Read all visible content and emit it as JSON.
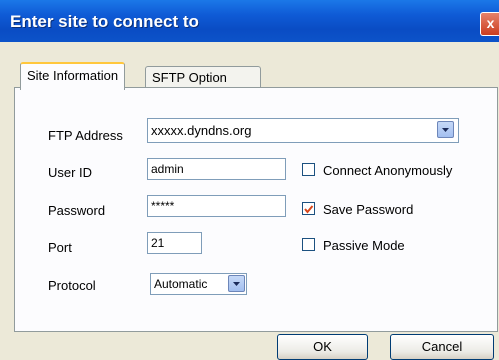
{
  "window": {
    "title": "Enter site to connect to",
    "close_label": "x"
  },
  "tabs": [
    {
      "label": "Site Information",
      "active": true
    },
    {
      "label": "SFTP Option",
      "active": false
    }
  ],
  "form": {
    "ftp_address_label": "FTP Address",
    "ftp_address_value": "xxxxx.dyndns.org",
    "user_id_label": "User ID",
    "user_id_value": "admin",
    "password_label": "Password",
    "password_value": "*****",
    "port_label": "Port",
    "port_value": "21",
    "protocol_label": "Protocol",
    "protocol_value": "Automatic"
  },
  "options": {
    "connect_anonymously": {
      "label": "Connect Anonymously",
      "checked": false
    },
    "save_password": {
      "label": "Save Password",
      "checked": true
    },
    "passive_mode": {
      "label": "Passive Mode",
      "checked": false
    }
  },
  "buttons": {
    "ok": "OK",
    "cancel": "Cancel"
  },
  "colors": {
    "titlebar": "#0a4cc4",
    "dialog_bg": "#ece9d8",
    "check_mark": "#d8461b"
  },
  "icons": [
    "close-icon",
    "dropdown-arrow-icon",
    "checkmark-icon"
  ]
}
